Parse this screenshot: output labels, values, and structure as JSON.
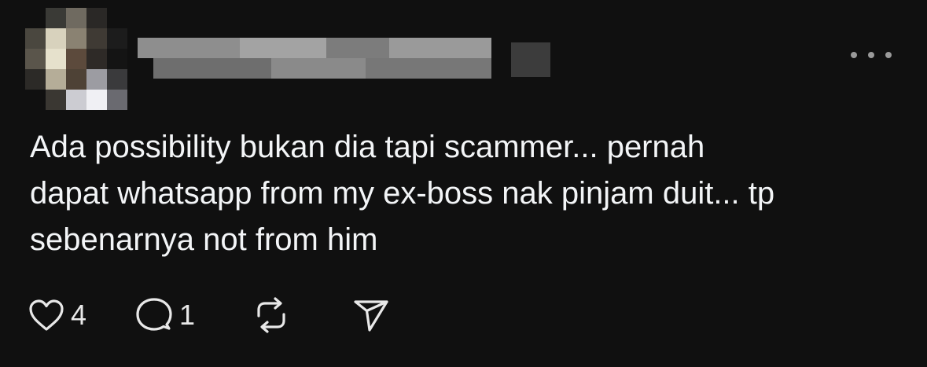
{
  "post": {
    "author": {
      "avatar_icon": "avatar-pixelated",
      "username_icon": "username-pixelated"
    },
    "text_lines": [
      "Ada possibility bukan dia tapi scammer... pernah",
      "dapat whatsapp from my ex-boss nak pinjam duit... tp",
      "sebenarnya not from him"
    ],
    "actions": {
      "like": {
        "icon": "heart-icon",
        "count": "4"
      },
      "comment": {
        "icon": "comment-icon",
        "count": "1"
      },
      "repost": {
        "icon": "repost-icon"
      },
      "share": {
        "icon": "send-icon"
      }
    },
    "more_icon": "more-horizontal-icon"
  },
  "colors": {
    "background": "#101010",
    "text": "#f3f5f7",
    "icon": "#e8e8e8",
    "muted": "#9a9a9a"
  }
}
